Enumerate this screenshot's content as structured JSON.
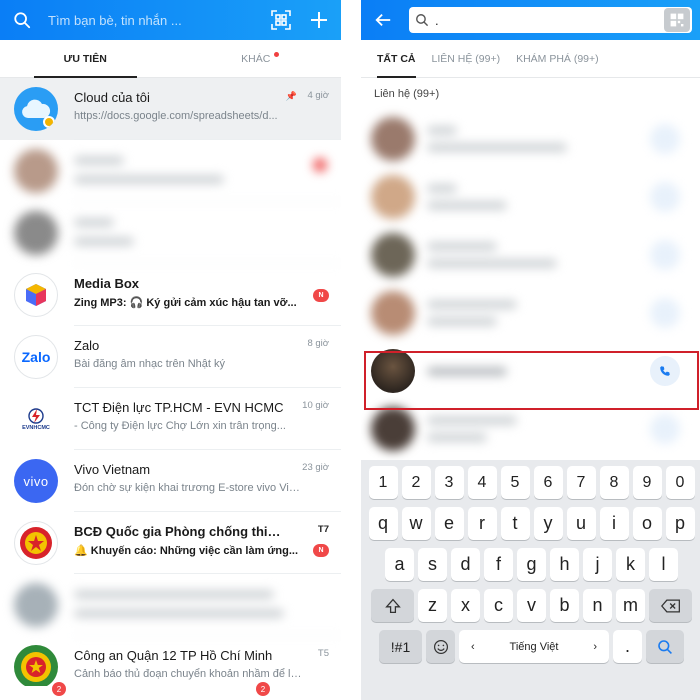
{
  "colors": {
    "accent": "#0a84f6",
    "badge": "#f04848",
    "highlight_border": "#d0202a"
  },
  "left": {
    "search_placeholder": "Tìm bạn bè, tin nhắn ...",
    "tabs": {
      "priority": "ƯU TIÊN",
      "other": "KHÁC"
    },
    "conversations": [
      {
        "title": "Cloud của tôi",
        "subtitle": "https://docs.google.com/spreadsheets/d...",
        "time": "4 giờ",
        "pinned": true,
        "icon": "cloud-icon"
      },
      {
        "blurred": true
      },
      {
        "blurred": true
      },
      {
        "title": "Media Box",
        "subtitle": "Zing MP3: 🎧 Ký gửi cảm xúc hậu tan vỡ...",
        "badge": "N",
        "bold": true,
        "icon": "media-box-icon"
      },
      {
        "title": "Zalo",
        "subtitle": "Bài đăng âm nhạc trên Nhật ký",
        "time": "8 giờ",
        "icon": "zalo-logo-icon"
      },
      {
        "title": "TCT Điện lực TP.HCM - EVN HCMC",
        "subtitle": "- Công ty Điện lực Chợ Lớn xin trân trọng...",
        "time": "10 giờ",
        "icon": "evn-logo-icon"
      },
      {
        "title": "Vivo Vietnam",
        "subtitle": "Đón chờ sự kiện khai trương E-store vivo Việt...",
        "time": "23 giờ",
        "icon": "vivo-logo-icon"
      },
      {
        "title": "BCĐ Quốc gia Phòng chống thiên tai",
        "subtitle": "🔔 Khuyến cáo: Những việc cần làm ứng...",
        "time": "T7",
        "badge": "N",
        "bold": true,
        "icon": "bcd-emblem-icon"
      },
      {
        "blurred": true
      },
      {
        "title": "Công an Quận 12 TP Hồ Chí Minh",
        "subtitle": "Cảnh báo thủ đoạn chuyển khoản nhầm để lừa",
        "time": "T5",
        "icon": "police-emblem-icon"
      }
    ],
    "nav_badges": [
      "2",
      "2"
    ],
    "logo_texts": {
      "zalo": "Zalo",
      "evn": "EVNHCMC",
      "vivo": "vivo"
    }
  },
  "right": {
    "search_value": ".",
    "tabs": {
      "all": "TẤT CẢ",
      "contacts": "LIÊN HỆ (99+)",
      "explore": "KHÁM PHÁ (99+)"
    },
    "section_label": "Liên hệ (99+)",
    "contact_count": 6,
    "keyboard": {
      "numbers": [
        "1",
        "2",
        "3",
        "4",
        "5",
        "6",
        "7",
        "8",
        "9",
        "0"
      ],
      "row1": [
        "q",
        "w",
        "e",
        "r",
        "t",
        "y",
        "u",
        "i",
        "o",
        "p"
      ],
      "row2": [
        "a",
        "s",
        "d",
        "f",
        "g",
        "h",
        "j",
        "k",
        "l"
      ],
      "row3": [
        "z",
        "x",
        "c",
        "v",
        "b",
        "n",
        "m"
      ],
      "symbols_label": "!#1",
      "comma": ",",
      "space_label": "Tiếng Việt",
      "space_left": "‹",
      "space_right": "›",
      "period": "."
    }
  }
}
